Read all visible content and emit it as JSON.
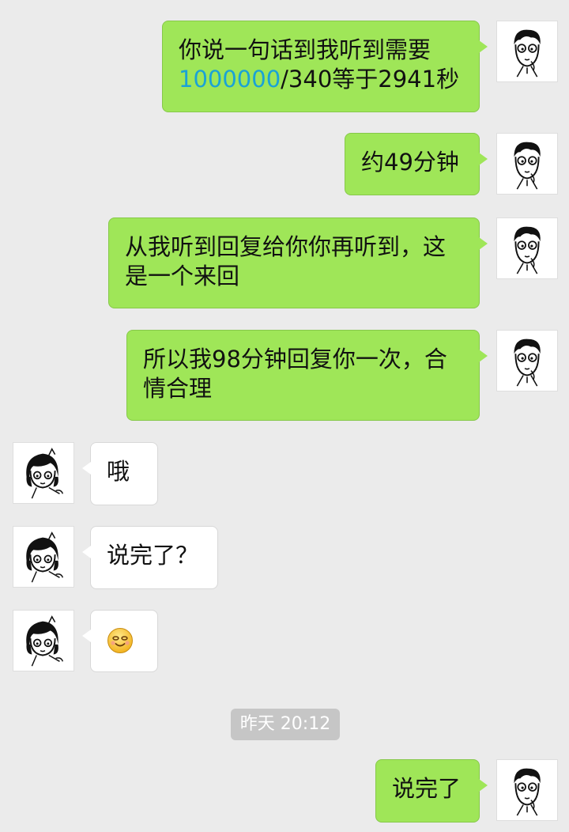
{
  "messages": [
    {
      "id": "m1",
      "side": "me",
      "parts": [
        {
          "text": "你说一句话到我听到需要"
        },
        {
          "text": "1000000",
          "link": true
        },
        {
          "text": "/340等于2941秒"
        }
      ]
    },
    {
      "id": "m2",
      "side": "me",
      "text": "约49分钟"
    },
    {
      "id": "m3",
      "side": "me",
      "text": "从我听到回复给你你再听到，这是一个来回"
    },
    {
      "id": "m4",
      "side": "me",
      "text": "所以我98分钟回复你一次，合情合理"
    },
    {
      "id": "m5",
      "side": "other",
      "text": "哦"
    },
    {
      "id": "m6",
      "side": "other",
      "text": "说完了？"
    },
    {
      "id": "m7",
      "side": "other",
      "emoji": "smile-emoji"
    },
    {
      "id": "m8",
      "side": "me",
      "text": "说完了"
    }
  ],
  "timestamp": "昨天 20:12",
  "colors": {
    "my_bubble": "#9fe658",
    "other_bubble": "#ffffff",
    "background": "#ebebeb",
    "link": "#1aa2d6"
  }
}
